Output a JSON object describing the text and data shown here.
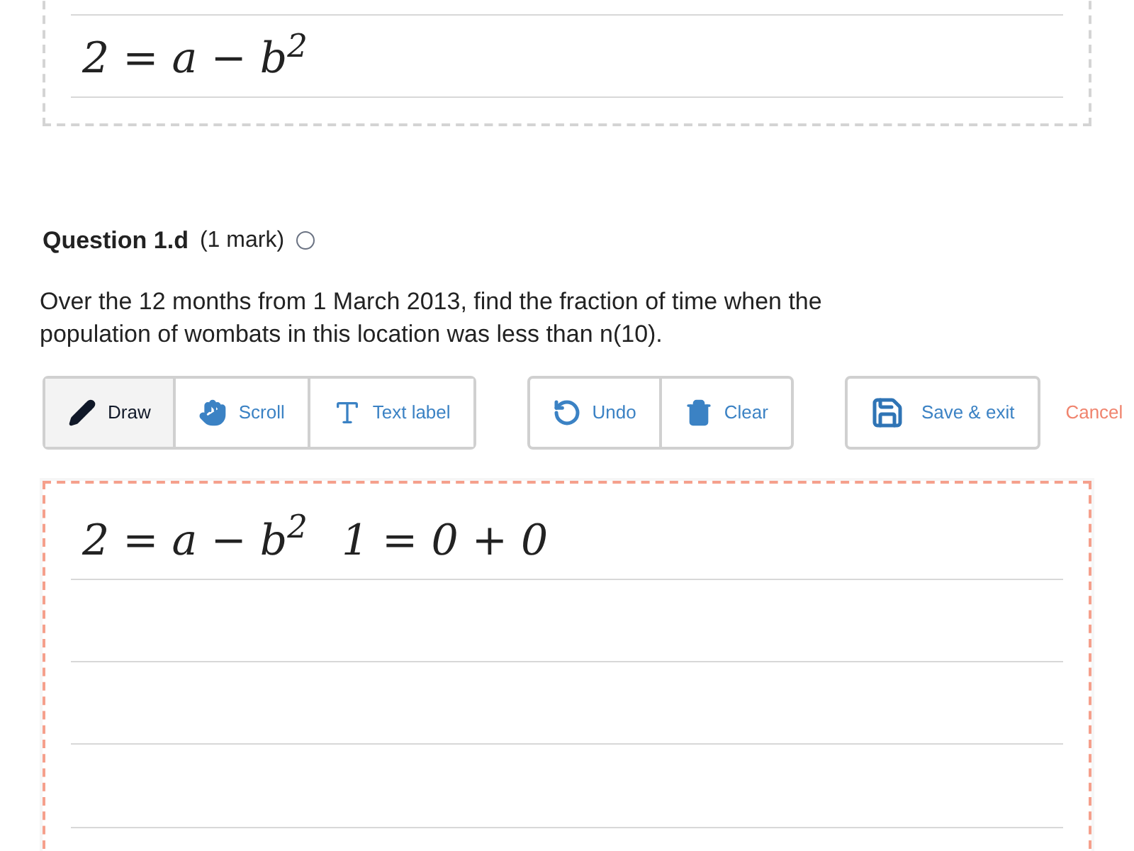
{
  "previous_answer": {
    "handwriting": "2 = a − b$^{2}$"
  },
  "question": {
    "number": "Question 1.d",
    "marks": "(1 mark)",
    "text": "Over the 12 months from 1 March 2013, find the fraction of time when the population of wombats in this location was less than n(10)."
  },
  "toolbar": {
    "tools": [
      {
        "kind": "draw",
        "label": "Draw",
        "selected": true
      },
      {
        "kind": "scroll",
        "label": "Scroll",
        "selected": false
      },
      {
        "kind": "text",
        "label": "Text label",
        "selected": false
      }
    ],
    "actions": [
      {
        "kind": "undo",
        "label": "Undo"
      },
      {
        "kind": "clear",
        "label": "Clear"
      }
    ],
    "save": "Save & exit",
    "cancel": "Cancel"
  },
  "answer": {
    "handwriting": [
      "2 = a − b$^{2}$",
      "1 = 0 + 0"
    ]
  }
}
